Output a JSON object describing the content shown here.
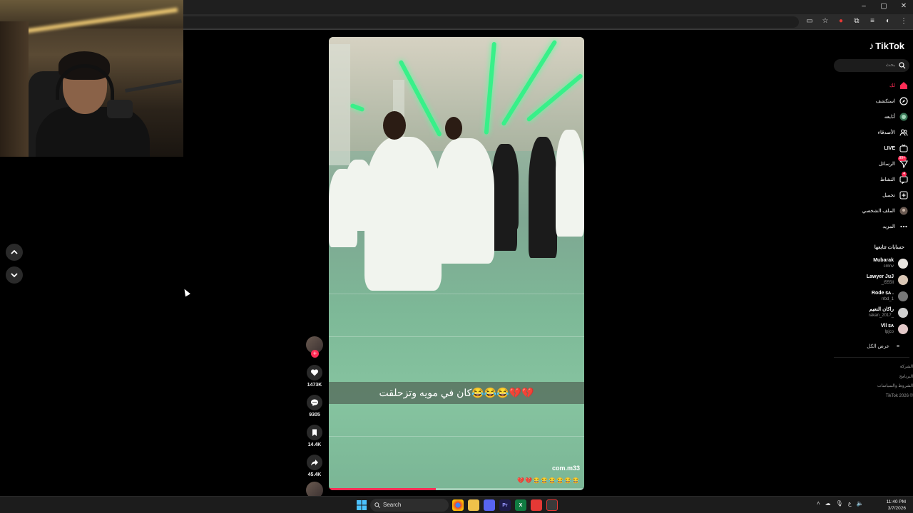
{
  "browser": {
    "window_controls": [
      "–",
      "▢",
      "✕"
    ]
  },
  "video": {
    "caption": "كان في مويه وتزحلقت😂😂😂💔💔",
    "watermark": "com.m33",
    "emoji_strip": "💔💔😂😂😂😂😂😂",
    "progress": 0.42
  },
  "actions": {
    "likes": "1473K",
    "comments": "9305",
    "saves": "14.4K",
    "shares": "45.4K"
  },
  "sidebar": {
    "logo": "TikTok",
    "search_placeholder": "بحث",
    "menu": [
      {
        "label": "لك",
        "icon": "home-icon",
        "active": true
      },
      {
        "label": "استكشف",
        "icon": "compass-icon"
      },
      {
        "label": "أتابعه",
        "icon": "following-avatar-icon"
      },
      {
        "label": "الأصدقاء",
        "icon": "friends-icon"
      },
      {
        "label": "LIVE",
        "icon": "live-icon"
      },
      {
        "label": "الرسائل",
        "icon": "messages-icon",
        "badge": "99+"
      },
      {
        "label": "النشاط",
        "icon": "activity-icon",
        "badge": "4"
      },
      {
        "label": "تحميل",
        "icon": "upload-icon"
      },
      {
        "label": "الملف الشخصي",
        "icon": "profile-icon"
      },
      {
        "label": "المزيد",
        "icon": "more-icon"
      }
    ],
    "following_title": "حسابات تتابعها",
    "following": [
      {
        "name": "Mubarak",
        "handle": "cmnv"
      },
      {
        "name": "Lawyer JuJ",
        "handle": "_l555ll"
      },
      {
        "name": "Rode ꜱᴀ .",
        "handle": "rrbd_1"
      },
      {
        "name": "راكان النعيم",
        "handle": "rakan_2017_"
      },
      {
        "name": "Vll ꜱᴀ",
        "handle": "lpjco"
      }
    ],
    "see_all": "عرض الكل",
    "footer": [
      "الشركة",
      "البرنامج",
      "الشروط والسياسات",
      "TikTok 2026 ©"
    ]
  },
  "taskbar": {
    "search_label": "Search",
    "tray_lang": "ع",
    "time": "11:40 PM",
    "date": "3/7/2026"
  },
  "colors": {
    "accent": "#fe2c55",
    "neon": "#38f089"
  }
}
